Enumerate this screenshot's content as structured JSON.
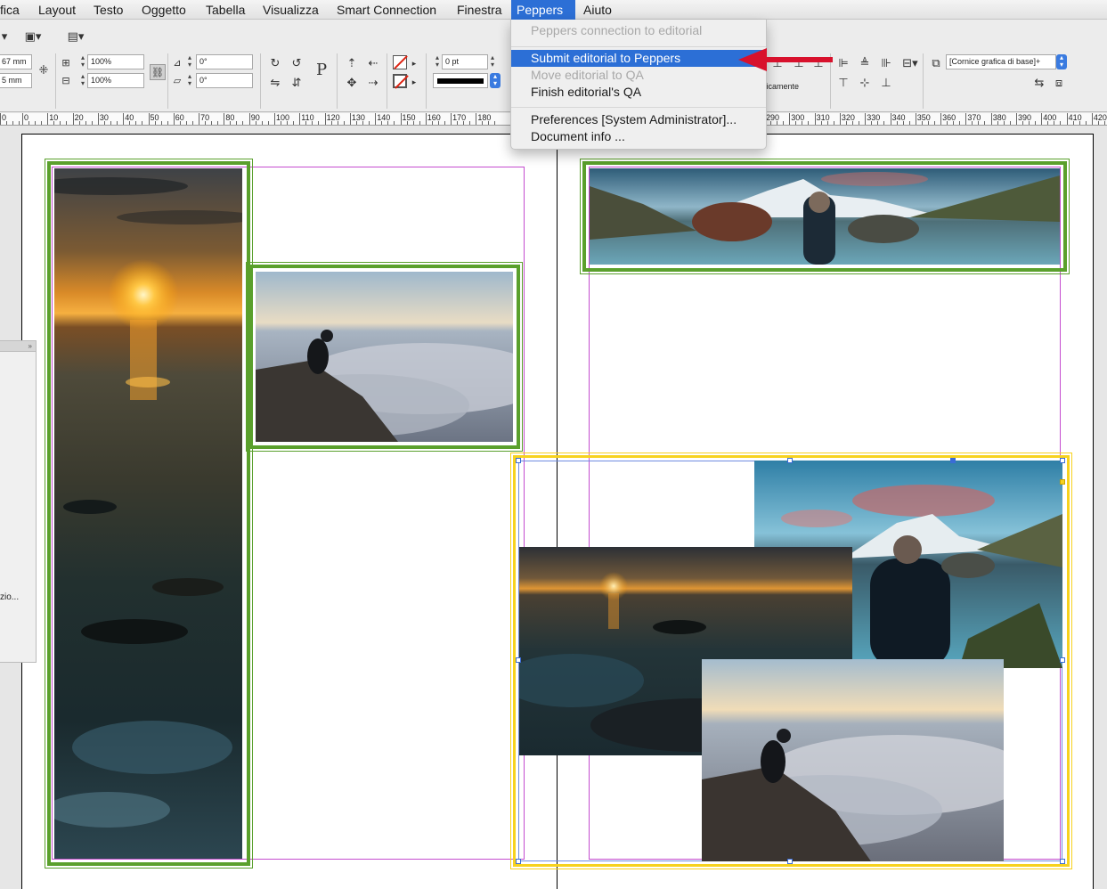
{
  "menubar": {
    "items": [
      "fica",
      "Layout",
      "Testo",
      "Oggetto",
      "Tabella",
      "Visualizza",
      "Smart Connection",
      "Finestra",
      "Peppers",
      "Aiuto"
    ],
    "active_index": 8
  },
  "dropdown": {
    "items": [
      {
        "label": "Peppers connection to editorial",
        "state": "disabled"
      },
      {
        "label": "Submit editorial to Peppers",
        "state": "selected"
      },
      {
        "label": "Move editorial to QA",
        "state": "disabled"
      },
      {
        "label": "Finish editorial's QA",
        "state": "enabled"
      },
      {
        "label": "Preferences  [System Administrator]...",
        "state": "enabled"
      },
      {
        "label": "Document info ...",
        "state": "enabled"
      }
    ]
  },
  "controlbar": {
    "x_value": "67 mm",
    "y_value": "5 mm",
    "scale_x": "100%",
    "scale_y": "100%",
    "rotate": "0°",
    "shear": "0°",
    "stroke_weight": "0 pt",
    "frame_style": "[Cornice grafica di base]+",
    "auto_fit_label": "ticamente",
    "paragraph_glyph": "P"
  },
  "ruler": {
    "labels": [
      "0",
      "0",
      "10",
      "20",
      "30",
      "40",
      "50",
      "60",
      "70",
      "80",
      "90",
      "100",
      "110",
      "120",
      "130",
      "140",
      "150",
      "160",
      "170",
      "180",
      "290",
      "300",
      "310",
      "320",
      "330",
      "340",
      "350",
      "360",
      "370",
      "380",
      "390",
      "400",
      "410",
      "420"
    ]
  },
  "side_panel": {
    "label": "zio..."
  },
  "colors": {
    "frame_green": "#5aa02c",
    "frame_yellow": "#f7d21e",
    "menu_highlight": "#2c6fd6",
    "arrow_red": "#d8112c",
    "guide_magenta": "#c44ccf"
  }
}
